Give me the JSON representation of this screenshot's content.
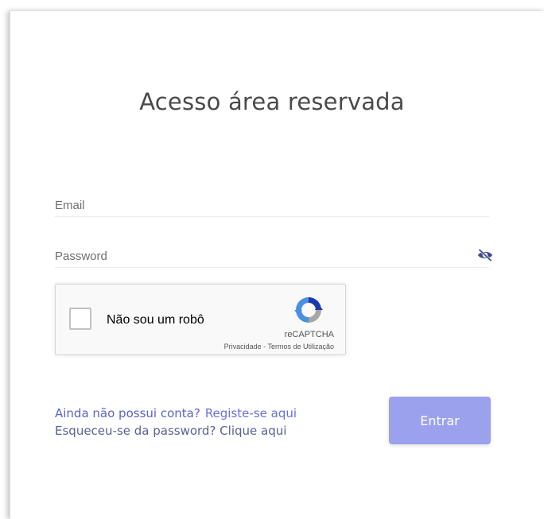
{
  "login": {
    "title": "Acesso área reservada",
    "email_placeholder": "Email",
    "password_placeholder": "Password",
    "password_toggle_icon": "eye-slash-icon",
    "submit_label": "Entrar"
  },
  "recaptcha": {
    "label": "Não sou um robô",
    "brand": "reCAPTCHA",
    "terms": "Privacidade - Termos de Utilização"
  },
  "links": {
    "no_account": "Ainda não possui conta?",
    "register": "Registe-se aqui",
    "forgot": "Esqueceu-se da password? Clique aqui"
  },
  "colors": {
    "accent": "#5a63c8",
    "button": "#9ba1ec",
    "title": "#4a4a4a"
  }
}
